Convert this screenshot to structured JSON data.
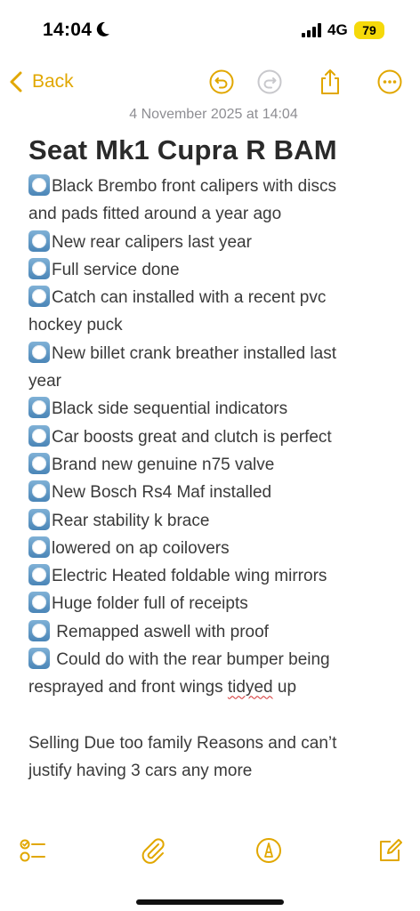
{
  "status_bar": {
    "time": "14:04",
    "network": "4G",
    "battery": "79",
    "icons": [
      "moon-icon",
      "signal-icon",
      "battery-icon"
    ]
  },
  "toolbar": {
    "back_label": "Back",
    "icons": [
      "chevron-left-icon",
      "undo-icon",
      "redo-icon",
      "share-icon",
      "more-icon"
    ],
    "accent_color": "#e1a700"
  },
  "note": {
    "date": "4 November 2025 at 14:04",
    "title": "Seat Mk1 Cupra R BAM",
    "items": [
      {
        "text": "Black Brembo front calipers with discs",
        "cont": "and pads fitted around a year ago"
      },
      {
        "text": "New rear calipers last year"
      },
      {
        "text": "Full service done"
      },
      {
        "text": "Catch can installed with a recent pvc",
        "cont": "hockey puck"
      },
      {
        "text": "New billet crank breather installed last",
        "cont": "year"
      },
      {
        "text": "Black side sequential indicators"
      },
      {
        "text": "Car boosts great and clutch is perfect"
      },
      {
        "text": "Brand new genuine n75 valve"
      },
      {
        "text": "New Bosch Rs4 Maf installed"
      },
      {
        "text": "Rear stability k brace"
      },
      {
        "text": "lowered on ap coilovers"
      },
      {
        "text": "Electric Heated foldable wing mirrors"
      },
      {
        "text": "Huge folder full of receipts"
      },
      {
        "text": " Remapped aswell with proof"
      },
      {
        "text": " Could do with the rear bumper being"
      }
    ],
    "last_cont_a": "resprayed and front wings ",
    "last_cont_misspelled": "tidyed",
    "last_cont_b": " up",
    "closing_line_1": "Selling Due too family Reasons and can’t",
    "closing_line_2": "justify having 3 cars any more"
  },
  "bottom_bar": {
    "icons": [
      "checklist-icon",
      "paperclip-icon",
      "markup-pen-icon",
      "compose-icon"
    ]
  }
}
